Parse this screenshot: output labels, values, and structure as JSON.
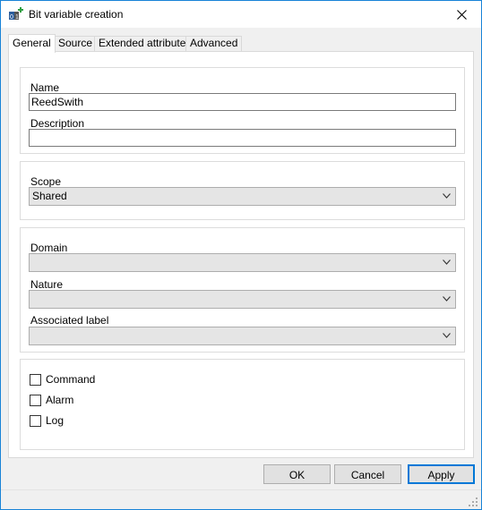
{
  "window": {
    "title": "Bit variable creation",
    "app_icon": "variable-plus-icon",
    "close_icon": "close-icon"
  },
  "tabs": [
    {
      "label": "General",
      "active": true
    },
    {
      "label": "Source",
      "active": false
    },
    {
      "label": "Extended attributes",
      "active": false
    },
    {
      "label": "Advanced",
      "active": false
    }
  ],
  "general": {
    "name_label": "Name",
    "name_value": "ReedSwith",
    "description_label": "Description",
    "description_value": "",
    "scope_label": "Scope",
    "scope_value": "Shared",
    "domain_label": "Domain",
    "domain_value": "",
    "nature_label": "Nature",
    "nature_value": "",
    "associated_label_label": "Associated label",
    "associated_label_value": "",
    "checkboxes": [
      {
        "label": "Command",
        "checked": false
      },
      {
        "label": "Alarm",
        "checked": false
      },
      {
        "label": "Log",
        "checked": false
      }
    ]
  },
  "buttons": {
    "ok": "OK",
    "cancel": "Cancel",
    "apply": "Apply"
  },
  "colors": {
    "accent": "#0078d7",
    "window_border": "#1883d7",
    "background": "#f0f0f0",
    "combo_background": "#e5e5e5"
  }
}
